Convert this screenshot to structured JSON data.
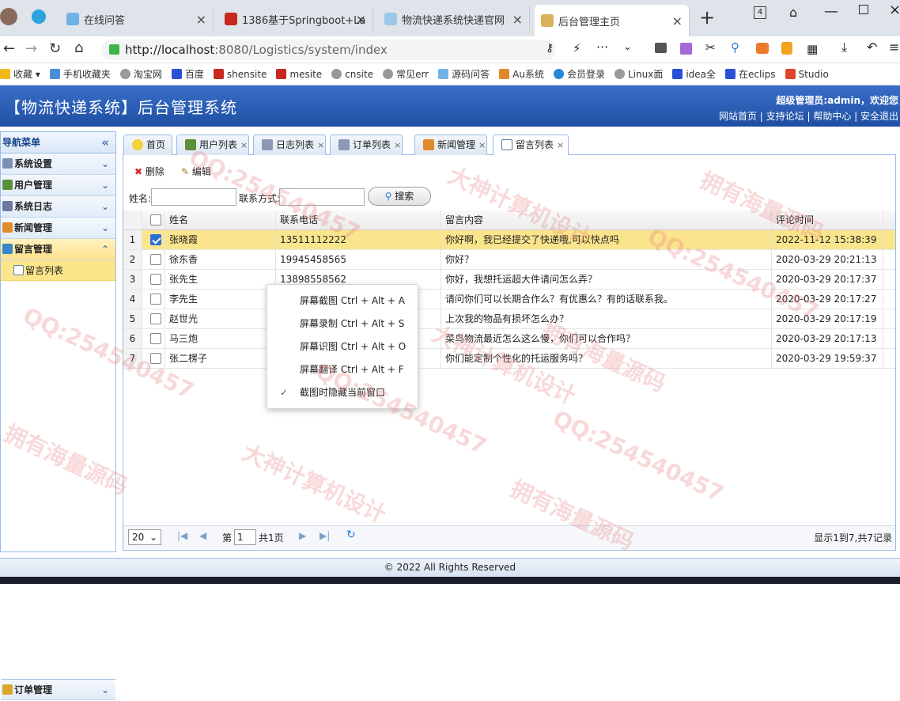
{
  "browser": {
    "tabs": [
      {
        "label": "在线问答"
      },
      {
        "label": "1386基于Springboot+La"
      },
      {
        "label": "物流快递系统快递官网"
      },
      {
        "label": "后台管理主页",
        "active": true
      }
    ],
    "new_tab": "+",
    "tab_count": "4",
    "url_host": "http://localhost",
    "url_path": ":8080/Logistics/system/index",
    "bookmarks": [
      "收藏",
      "手机收藏夹",
      "淘宝网",
      "百度",
      "shensite",
      "mesite",
      "cnsite",
      "常见err",
      "源码问答",
      "Au系统",
      "会员登录",
      "Linux面",
      "idea全",
      "在eclips",
      "Studio"
    ]
  },
  "app": {
    "title": "【物流快递系统】后台管理系统",
    "user_line": "超级管理员:admin，欢迎您",
    "top_links": "网站首页 | 支持论坛 | 帮助中心 | 安全退出"
  },
  "nav": {
    "header": "导航菜单",
    "collapse": "«",
    "groups": [
      {
        "label": "系统设置",
        "color": "#7b8fb3"
      },
      {
        "label": "用户管理",
        "color": "#5b8f3a"
      },
      {
        "label": "系统日志",
        "color": "#6a7aa0"
      },
      {
        "label": "新闻管理",
        "color": "#e08a2a"
      },
      {
        "label": "留言管理",
        "color": "#3a86c8"
      }
    ],
    "sub_item": "留言列表",
    "bottom_group": "订单管理"
  },
  "tabs": [
    {
      "label": "首页",
      "closable": false
    },
    {
      "label": "用户列表",
      "closable": true
    },
    {
      "label": "日志列表",
      "closable": true
    },
    {
      "label": "订单列表",
      "closable": true
    },
    {
      "label": "新闻管理",
      "closable": true
    },
    {
      "label": "留言列表",
      "closable": true
    }
  ],
  "toolbar": {
    "delete_label": "删除",
    "edit_label": "编辑"
  },
  "search": {
    "name_label": "姓名:",
    "contact_label": "联系方式:",
    "button_label": "搜索"
  },
  "grid": {
    "columns": [
      "姓名",
      "联系电话",
      "留言内容",
      "评论时间"
    ],
    "rows": [
      {
        "no": "1",
        "name": "张晓霞",
        "phone": "13511112222",
        "content": "你好啊，我已经提交了快递哦,可以快点吗",
        "time": "2022-11-12 15:38:39",
        "checked": true
      },
      {
        "no": "2",
        "name": "徐东香",
        "phone": "19945458565",
        "content": "你好？",
        "time": "2020-03-29 20:21:13",
        "checked": false
      },
      {
        "no": "3",
        "name": "张先生",
        "phone": "13898558562",
        "content": "你好，我想托运超大件请问怎么弄？",
        "time": "2020-03-29 20:17:37",
        "checked": false
      },
      {
        "no": "4",
        "name": "李先生",
        "phone": "",
        "content": "请问你们可以长期合作么？有优惠么？有的话联系我。",
        "time": "2020-03-29 20:17:27",
        "checked": false
      },
      {
        "no": "5",
        "name": "赵世光",
        "phone": "",
        "content": "上次我的物品有损坏怎么办？",
        "time": "2020-03-29 20:17:19",
        "checked": false
      },
      {
        "no": "6",
        "name": "马三炮",
        "phone": "",
        "content": "菜鸟物流最近怎么这么慢，你们可以合作吗？",
        "time": "2020-03-29 20:17:13",
        "checked": false
      },
      {
        "no": "7",
        "name": "张二楞子",
        "phone": "",
        "content": "你们能定制个性化的托运服务吗？",
        "time": "2020-03-29 19:59:37",
        "checked": false
      }
    ]
  },
  "pager": {
    "page_size": "20",
    "page_prefix": "第",
    "page_value": "1",
    "page_suffix": "共1页",
    "summary": "显示1到7,共7记录"
  },
  "context_menu": [
    {
      "label": "屏幕截图 Ctrl + Alt + A",
      "checked": false
    },
    {
      "label": "屏幕录制 Ctrl + Alt + S",
      "checked": false
    },
    {
      "label": "屏幕识图 Ctrl + Alt + O",
      "checked": false
    },
    {
      "label": "屏幕翻译 Ctrl + Alt + F",
      "checked": false
    },
    {
      "label": "截图时隐藏当前窗口",
      "checked": true
    }
  ],
  "footer": "© 2022 All Rights Reserved",
  "watermarks": [
    "QQ:254540457",
    "拥有海量源码",
    "大神计算机设计"
  ]
}
